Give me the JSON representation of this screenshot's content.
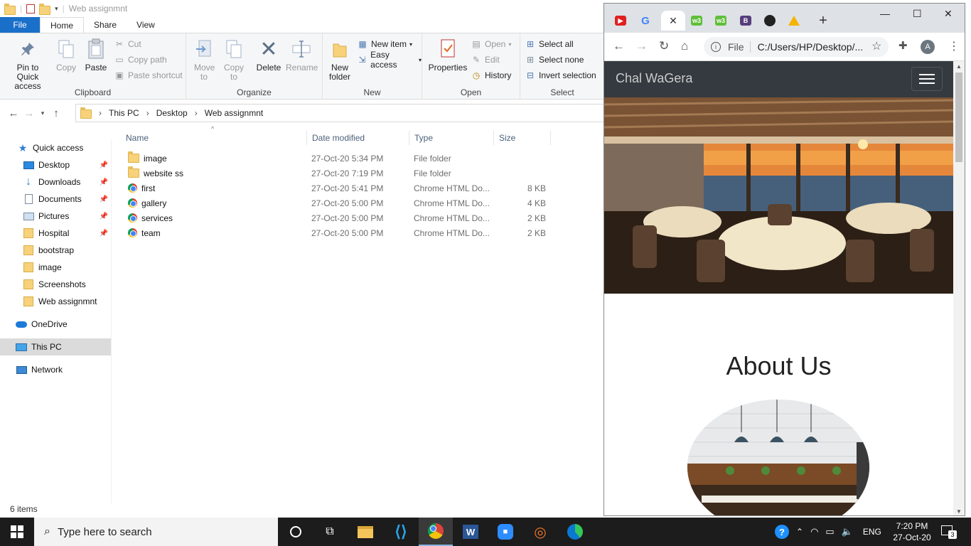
{
  "explorer": {
    "title": "Web assignmnt",
    "tabs": [
      "File",
      "Home",
      "Share",
      "View"
    ],
    "ribbon": {
      "clipboard": {
        "label": "Clipboard",
        "pin": "Pin to Quick access",
        "copy": "Copy",
        "paste": "Paste",
        "cut": "Cut",
        "copy_path": "Copy path",
        "paste_shortcut": "Paste shortcut"
      },
      "organize": {
        "label": "Organize",
        "move_to": "Move to",
        "copy_to": "Copy to",
        "delete": "Delete",
        "rename": "Rename"
      },
      "new": {
        "label": "New",
        "new_folder": "New folder",
        "new_item": "New item",
        "easy_access": "Easy access"
      },
      "open": {
        "label": "Open",
        "properties": "Properties",
        "open": "Open",
        "edit": "Edit",
        "history": "History"
      },
      "select": {
        "label": "Select",
        "select_all": "Select all",
        "select_none": "Select none",
        "invert": "Invert selection"
      }
    },
    "breadcrumb": [
      "This PC",
      "Desktop",
      "Web assignmnt"
    ],
    "sidebar": [
      {
        "label": "Quick access",
        "icon": "star-icon"
      },
      {
        "label": "Desktop",
        "icon": "desktop-icon",
        "pinned": true
      },
      {
        "label": "Downloads",
        "icon": "download-icon",
        "pinned": true
      },
      {
        "label": "Documents",
        "icon": "documents-icon",
        "pinned": true
      },
      {
        "label": "Pictures",
        "icon": "pictures-icon",
        "pinned": true
      },
      {
        "label": "Hospital",
        "icon": "folder-icon",
        "pinned": true
      },
      {
        "label": "bootstrap",
        "icon": "folder-icon"
      },
      {
        "label": "image",
        "icon": "folder-icon"
      },
      {
        "label": "Screenshots",
        "icon": "folder-icon"
      },
      {
        "label": "Web assignmnt",
        "icon": "folder-icon"
      },
      {
        "label": "OneDrive",
        "icon": "cloud-icon"
      },
      {
        "label": "This PC",
        "icon": "pc-icon",
        "selected": true
      },
      {
        "label": "Network",
        "icon": "network-icon"
      }
    ],
    "columns": [
      "Name",
      "Date modified",
      "Type",
      "Size"
    ],
    "files": [
      {
        "name": "image",
        "date": "27-Oct-20 5:34 PM",
        "type": "File folder",
        "size": "",
        "icon": "folder-icon"
      },
      {
        "name": "website ss",
        "date": "27-Oct-20 7:19 PM",
        "type": "File folder",
        "size": "",
        "icon": "folder-icon"
      },
      {
        "name": "first",
        "date": "27-Oct-20 5:41 PM",
        "type": "Chrome HTML Do...",
        "size": "8 KB",
        "icon": "chrome-icon"
      },
      {
        "name": "gallery",
        "date": "27-Oct-20 5:00 PM",
        "type": "Chrome HTML Do...",
        "size": "4 KB",
        "icon": "chrome-icon"
      },
      {
        "name": "services",
        "date": "27-Oct-20 5:00 PM",
        "type": "Chrome HTML Do...",
        "size": "2 KB",
        "icon": "chrome-icon"
      },
      {
        "name": "team",
        "date": "27-Oct-20 5:00 PM",
        "type": "Chrome HTML Do...",
        "size": "2 KB",
        "icon": "chrome-icon"
      }
    ],
    "status": "6 items"
  },
  "browser": {
    "address_prefix": "File",
    "address": "C:/Users/HP/Desktop/...",
    "avatar_letter": "A",
    "page": {
      "brand": "Chal WaGera",
      "about_title": "About Us"
    }
  },
  "taskbar": {
    "search_placeholder": "Type here to search",
    "language": "ENG",
    "time": "7:20 PM",
    "date": "27-Oct-20",
    "notification_count": "3"
  }
}
